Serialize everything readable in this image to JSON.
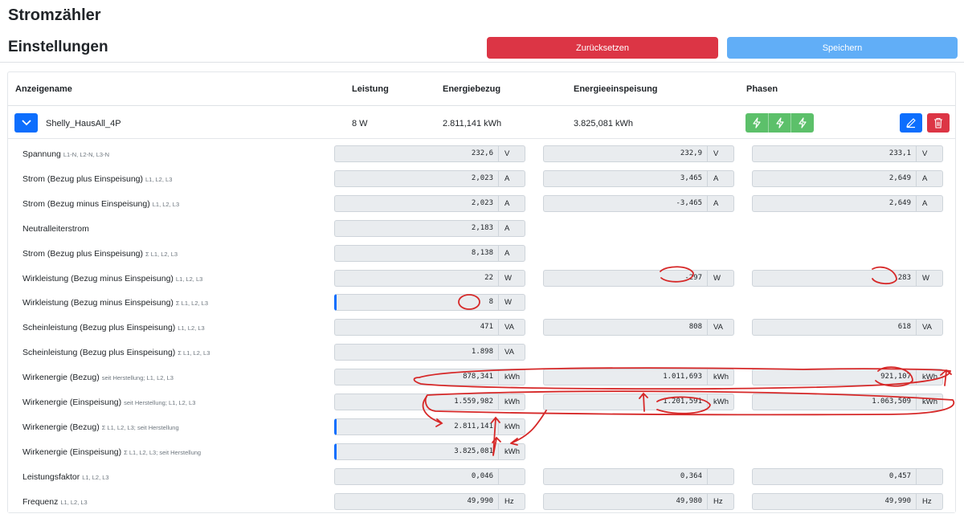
{
  "app": {
    "title": "Stromzähler",
    "section": "Einstellungen"
  },
  "toolbar": {
    "reset_label": "Zurücksetzen",
    "save_label": "Speichern"
  },
  "table": {
    "headers": {
      "name": "Anzeigename",
      "power": "Leistung",
      "import": "Energiebezug",
      "export": "Energieeinspeisung",
      "phases": "Phasen"
    }
  },
  "device": {
    "name": "Shelly_HausAll_4P",
    "power": "8 W",
    "import": "2.811,141 kWh",
    "export": "3.825,081 kWh"
  },
  "icons": {
    "expand": "chevron-down-icon",
    "phase": "lightning-icon",
    "edit": "pencil-icon",
    "delete": "trash-icon"
  },
  "colors": {
    "primary": "#0d6efd",
    "danger": "#dc3545",
    "save": "#61aef7",
    "success": "#5cc06a",
    "annotation": "#d62828"
  },
  "values": [
    {
      "label": "Spannung",
      "sub": "L1-N, L2-N, L3-N",
      "cells": [
        {
          "v": "232,6",
          "u": "V"
        },
        {
          "v": "232,9",
          "u": "V"
        },
        {
          "v": "233,1",
          "u": "V"
        }
      ]
    },
    {
      "label": "Strom (Bezug plus Einspeisung)",
      "sub": "L1, L2, L3",
      "cells": [
        {
          "v": "2,023",
          "u": "A"
        },
        {
          "v": "3,465",
          "u": "A"
        },
        {
          "v": "2,649",
          "u": "A"
        }
      ]
    },
    {
      "label": "Strom (Bezug minus Einspeisung)",
      "sub": "L1, L2, L3",
      "cells": [
        {
          "v": "2,023",
          "u": "A"
        },
        {
          "v": "-3,465",
          "u": "A"
        },
        {
          "v": "2,649",
          "u": "A"
        }
      ]
    },
    {
      "label": "Neutralleiterstrom",
      "sub": "",
      "cells": [
        {
          "v": "2,183",
          "u": "A"
        }
      ]
    },
    {
      "label": "Strom (Bezug plus Einspeisung)",
      "sub": "Σ L1, L2, L3",
      "cells": [
        {
          "v": "8,138",
          "u": "A"
        }
      ]
    },
    {
      "label": "Wirkleistung (Bezug minus Einspeisung)",
      "sub": "L1, L2, L3",
      "cells": [
        {
          "v": "22",
          "u": "W"
        },
        {
          "v": "-297",
          "u": "W"
        },
        {
          "v": "283",
          "u": "W"
        }
      ]
    },
    {
      "label": "Wirkleistung (Bezug minus Einspeisung)",
      "sub": "Σ L1, L2, L3",
      "accent": true,
      "cells": [
        {
          "v": "8",
          "u": "W"
        }
      ]
    },
    {
      "label": "Scheinleistung (Bezug plus Einspeisung)",
      "sub": "L1, L2, L3",
      "cells": [
        {
          "v": "471",
          "u": "VA"
        },
        {
          "v": "808",
          "u": "VA"
        },
        {
          "v": "618",
          "u": "VA"
        }
      ]
    },
    {
      "label": "Scheinleistung (Bezug plus Einspeisung)",
      "sub": "Σ L1, L2, L3",
      "cells": [
        {
          "v": "1.898",
          "u": "VA"
        }
      ]
    },
    {
      "label": "Wirkenergie (Bezug)",
      "sub": "seit Herstellung; L1, L2, L3",
      "cells": [
        {
          "v": "878,341",
          "u": "kWh"
        },
        {
          "v": "1.011,693",
          "u": "kWh"
        },
        {
          "v": "921,107",
          "u": "kWh"
        }
      ]
    },
    {
      "label": "Wirkenergie (Einspeisung)",
      "sub": "seit Herstellung; L1, L2, L3",
      "cells": [
        {
          "v": "1.559,982",
          "u": "kWh"
        },
        {
          "v": "1.201,591",
          "u": "kWh"
        },
        {
          "v": "1.063,509",
          "u": "kWh"
        }
      ]
    },
    {
      "label": "Wirkenergie (Bezug)",
      "sub": "Σ L1, L2, L3; seit Herstellung",
      "accent": true,
      "cells": [
        {
          "v": "2.811,141",
          "u": "kWh"
        }
      ]
    },
    {
      "label": "Wirkenergie (Einspeisung)",
      "sub": "Σ L1, L2, L3; seit Herstellung",
      "accent": true,
      "cells": [
        {
          "v": "3.825,081",
          "u": "kWh"
        }
      ]
    },
    {
      "label": "Leistungsfaktor",
      "sub": "L1, L2, L3",
      "cells": [
        {
          "v": "0,046",
          "u": ""
        },
        {
          "v": "0,364",
          "u": ""
        },
        {
          "v": "0,457",
          "u": ""
        }
      ]
    },
    {
      "label": "Frequenz",
      "sub": "L1, L2, L3",
      "cells": [
        {
          "v": "49,990",
          "u": "Hz"
        },
        {
          "v": "49,980",
          "u": "Hz"
        },
        {
          "v": "49,990",
          "u": "Hz"
        }
      ]
    }
  ]
}
